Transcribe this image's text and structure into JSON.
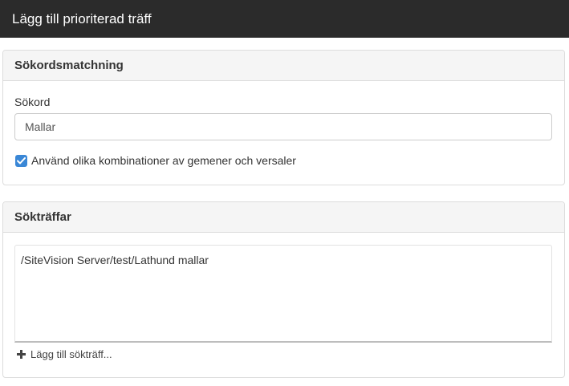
{
  "dialog": {
    "title": "Lägg till prioriterad träff"
  },
  "matching": {
    "heading": "Sökordsmatchning",
    "keyword_label": "Sökord",
    "keyword_value": "Mallar",
    "case_checkbox": {
      "label": "Använd olika kombinationer av gemener och versaler",
      "checked": true
    }
  },
  "hits": {
    "heading": "Sökträffar",
    "items": [
      "/SiteVision Server/test/Lathund mallar"
    ],
    "add_label": "Lägg till sökträff..."
  },
  "colors": {
    "titlebar": "#2b2b2b",
    "accent": "#3a87d6"
  }
}
